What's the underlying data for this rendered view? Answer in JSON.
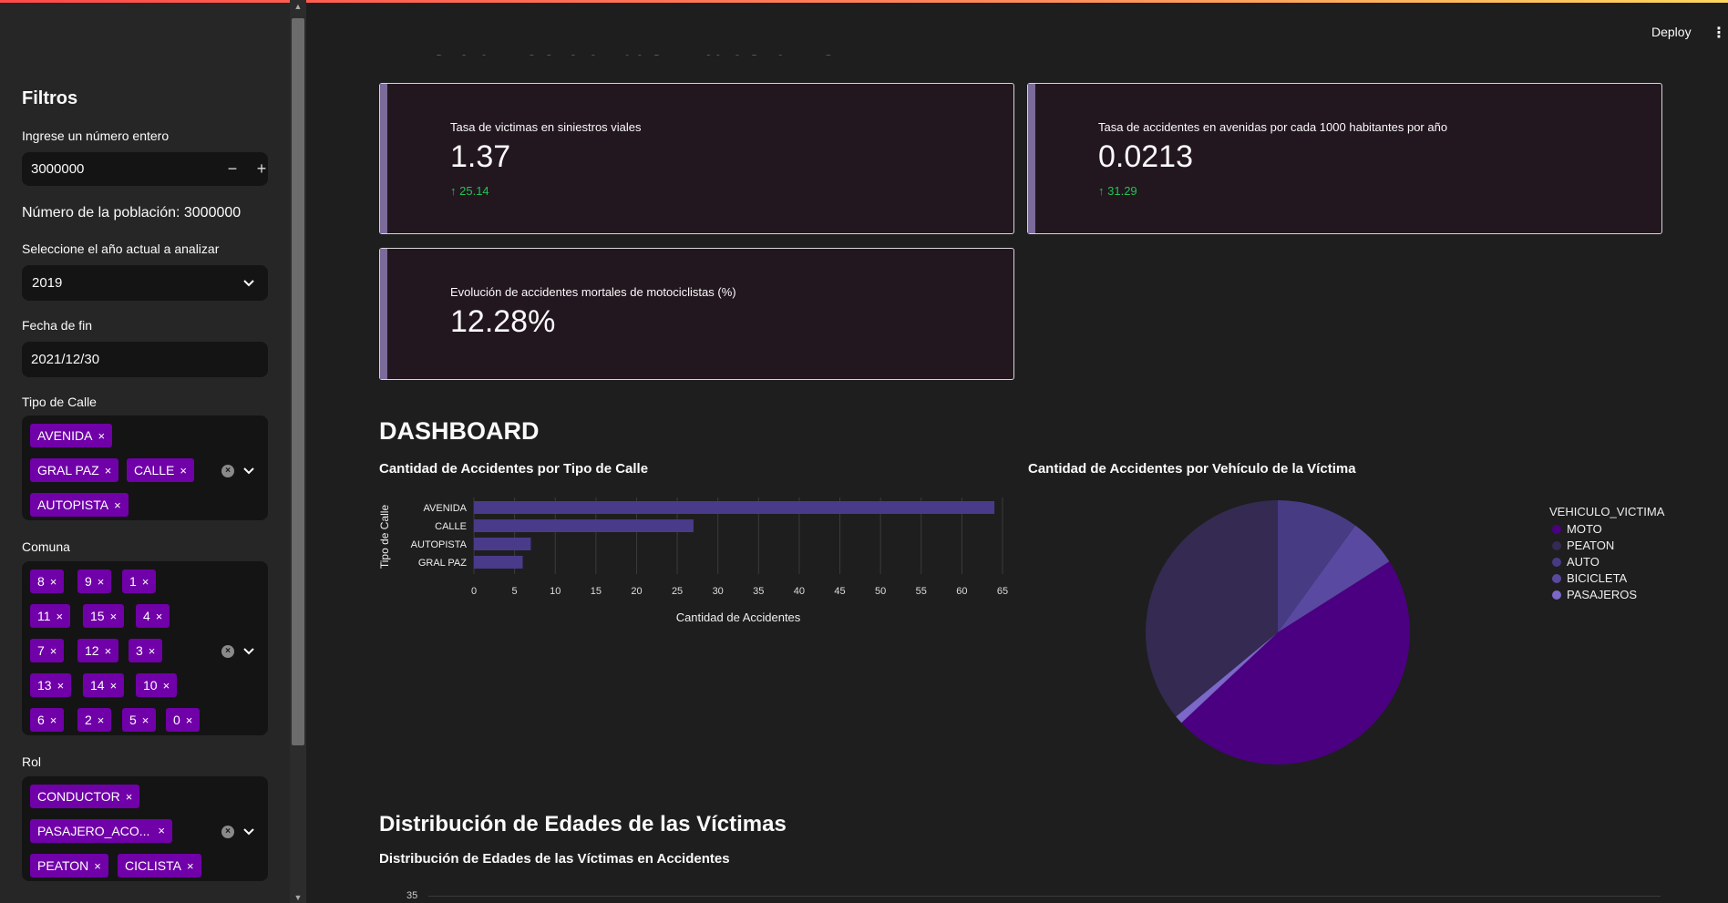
{
  "app": {
    "deploy_label": "Deploy",
    "menu_glyph": "⋮",
    "page_title": "KPIs de Accidentes Viales en CABA"
  },
  "sidebar": {
    "title": "Filtros",
    "number_input": {
      "label": "Ingrese un número entero",
      "value": "3000000",
      "minus": "−",
      "plus": "+"
    },
    "population_text": "Número de la población: 3000000",
    "year_select": {
      "label": "Seleccione el año actual a analizar",
      "value": "2019"
    },
    "end_date": {
      "label": "Fecha de fin",
      "value": "2021/12/30"
    },
    "street_type": {
      "label": "Tipo de Calle",
      "tags": [
        "AVENIDA",
        "GRAL PAZ",
        "CALLE",
        "AUTOPISTA"
      ]
    },
    "comuna": {
      "label": "Comuna",
      "tags": [
        "8",
        "9",
        "1",
        "11",
        "15",
        "4",
        "7",
        "12",
        "3",
        "13",
        "14",
        "10",
        "6",
        "2",
        "5",
        "0"
      ]
    },
    "rol": {
      "label": "Rol",
      "tags": [
        "CONDUCTOR",
        "PASAJERO_ACO...",
        "PEATON",
        "CICLISTA"
      ]
    },
    "tag_close": "×",
    "clear_glyph": "×"
  },
  "kpis": [
    {
      "label": "Tasa de victimas en siniestros viales",
      "value": "1.37",
      "delta": "25.14",
      "delta_arrow": "↑"
    },
    {
      "label": "Tasa de accidentes en avenidas por cada 1000 habitantes por año",
      "value": "0.0213",
      "delta": "31.29",
      "delta_arrow": "↑"
    },
    {
      "label": "Evolución de accidentes mortales de motociclistas (%)",
      "value": "12.28%"
    }
  ],
  "dashboard": {
    "heading": "DASHBOARD",
    "bar_title": "Cantidad de Accidentes por Tipo de Calle",
    "pie_title": "Cantidad de Accidentes por Vehículo de la Víctima",
    "age_heading": "Distribución de Edades de las Víctimas",
    "age_chart_title": "Distribución de Edades de las Víctimas en Accidentes",
    "age_axis_top_tick": "35"
  },
  "chart_data": [
    {
      "type": "bar",
      "orientation": "horizontal",
      "title": "Cantidad de Accidentes por Tipo de Calle",
      "xlabel": "Cantidad de Accidentes",
      "ylabel": "Tipo de Calle",
      "categories": [
        "AVENIDA",
        "CALLE",
        "AUTOPISTA",
        "GRAL PAZ"
      ],
      "values": [
        64,
        27,
        7,
        6
      ],
      "xlim": [
        0,
        65
      ],
      "xticks": [
        0,
        5,
        10,
        15,
        20,
        25,
        30,
        35,
        40,
        45,
        50,
        55,
        60,
        65
      ],
      "color": "#4a3a8a",
      "grid": true
    },
    {
      "type": "pie",
      "title": "Cantidad de Accidentes por Vehículo de la Víctima",
      "legend_title": "VEHICULO_VICTIMA",
      "legend_position": "top-right",
      "categories": [
        "MOTO",
        "PEATON",
        "AUTO",
        "BICICLETA",
        "PASAJEROS"
      ],
      "values": [
        47,
        36,
        10,
        6,
        1
      ],
      "colors": [
        "#4b0082",
        "#342a52",
        "#473b84",
        "#5a49a0",
        "#7b68c8"
      ]
    }
  ]
}
